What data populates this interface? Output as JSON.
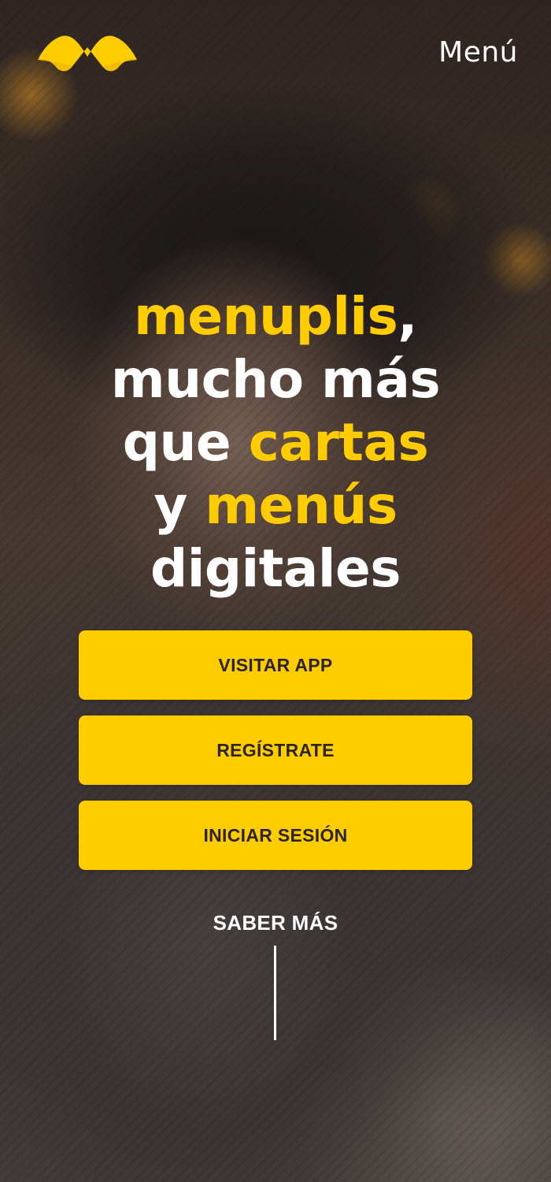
{
  "header": {
    "logo_icon": "menuplis-logo-icon",
    "menu_label": "Menú"
  },
  "headline": {
    "line1_yellow": "menuplis",
    "line1_rest": ",",
    "line2": "mucho más",
    "line3_white": "que ",
    "line3_yellow": "cartas",
    "line4_white": "y ",
    "line4_yellow": "menús",
    "line5": "digitales"
  },
  "buttons": {
    "visit_app": "VISITAR APP",
    "register": "REGÍSTRATE",
    "login": "INICIAR SESIÓN"
  },
  "learn_more": "SABER MÁS",
  "colors": {
    "accent": "#ffcc00",
    "button_text": "#2c2418",
    "headline_white": "#ffffff"
  }
}
